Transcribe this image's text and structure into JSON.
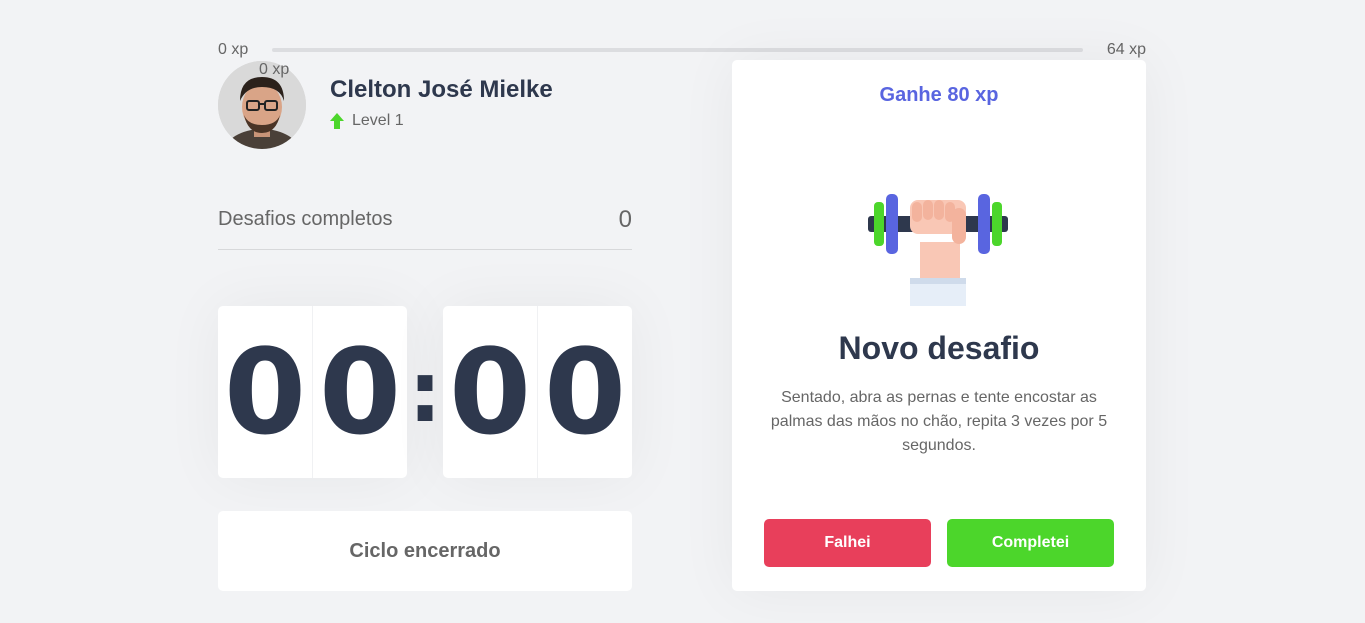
{
  "xp": {
    "min_label": "0 xp",
    "max_label": "64 xp",
    "current_label": "0 xp",
    "progress": 0
  },
  "profile": {
    "name": "Clelton José Mielke",
    "level_label": "Level 1",
    "avatar_icon": "user-avatar-photo",
    "level_icon": "arrow-up-icon"
  },
  "stats": {
    "completed_label": "Desafios completos",
    "completed_count": "0"
  },
  "countdown": {
    "minute_left": "0",
    "minute_right": "0",
    "separator": ":",
    "second_left": "0",
    "second_right": "0"
  },
  "cycle": {
    "button_label": "Ciclo encerrado"
  },
  "challenge": {
    "gain_label": "Ganhe 80 xp",
    "icon": "dumbbell-icon",
    "title": "Novo desafio",
    "description": "Sentado, abra as pernas e tente encostar as palmas das mãos no chão, repita 3 vezes por 5 segundos.",
    "fail_label": "Falhei",
    "complete_label": "Completei"
  },
  "colors": {
    "background": "#f2f3f5",
    "title": "#2e384d",
    "text": "#666666",
    "accent_blue": "#5965e0",
    "red": "#e83f5b",
    "green": "#4cd62b"
  }
}
